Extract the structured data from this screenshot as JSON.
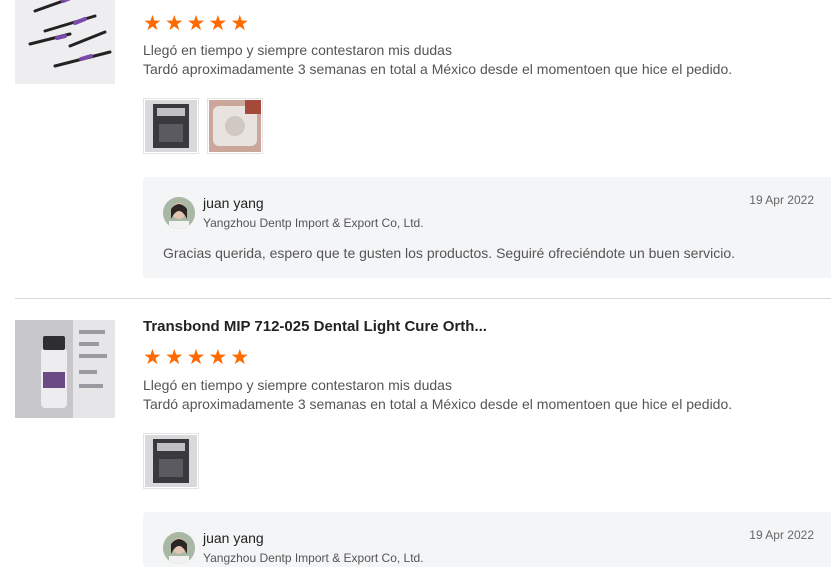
{
  "reviews": [
    {
      "product_title": "",
      "rating": 5,
      "review_lines": [
        "Llegó en tiempo y siempre contestaron mis dudas",
        "Tardó aproximadamente 3 semanas en total a México desde el momentoen que hice el pedido."
      ],
      "photos": 2,
      "reply": {
        "seller_name": "juan yang",
        "company": "Yangzhou Dentp Import & Export Co, Ltd.",
        "date": "19 Apr 2022",
        "text": "Gracias querida, espero que te gusten los productos. Seguiré ofreciéndote un buen servicio."
      }
    },
    {
      "product_title": "Transbond MIP 712-025 Dental Light Cure Orth...",
      "rating": 5,
      "review_lines": [
        "Llegó en tiempo y siempre contestaron mis dudas",
        "Tardó aproximadamente 3 semanas en total a México desde el momentoen que hice el pedido."
      ],
      "photos": 1,
      "reply": {
        "seller_name": "juan yang",
        "company": "Yangzhou Dentp Import & Export Co, Ltd.",
        "date": "19 Apr 2022",
        "text": ""
      }
    }
  ],
  "star_glyph": "★",
  "colors": {
    "star": "#ff6a00",
    "reply_bg": "#f4f5f7",
    "divider": "#d8d8d8"
  }
}
